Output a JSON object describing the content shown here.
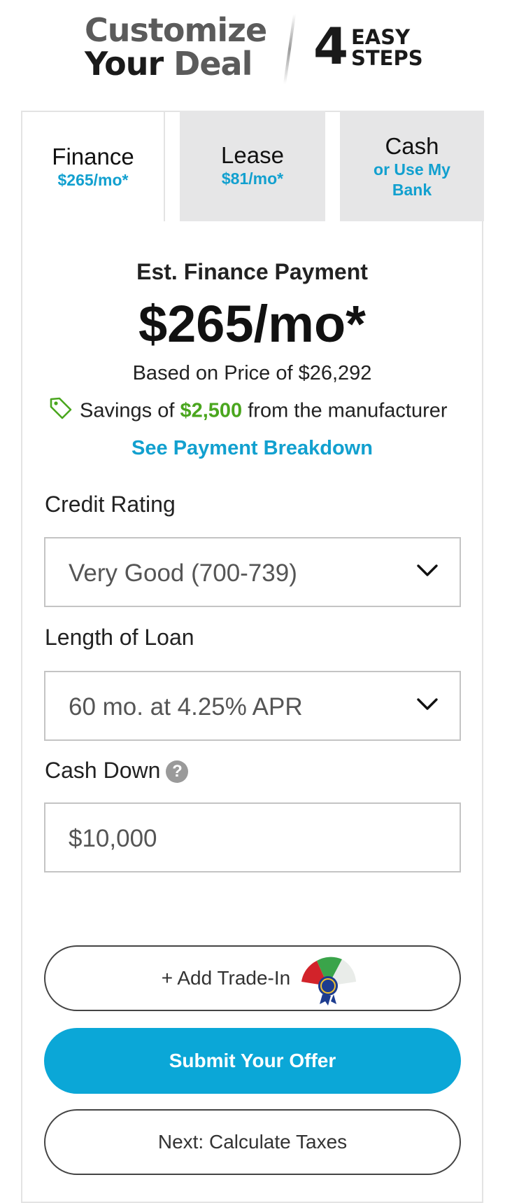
{
  "header": {
    "logo_line1": "Customize",
    "logo_line2a": "Your",
    "logo_line2b": "Deal",
    "steps_number": "4",
    "steps_easy": "EASY",
    "steps_steps": "STEPS"
  },
  "tabs": [
    {
      "title": "Finance",
      "subtitle": "$265/mo*",
      "active": true
    },
    {
      "title": "Lease",
      "subtitle": "$81/mo*",
      "active": false
    },
    {
      "title": "Cash",
      "subtitle": "or Use My Bank",
      "active": false
    }
  ],
  "summary": {
    "label": "Est. Finance Payment",
    "payment": "$265/mo*",
    "based_on": "Based on Price of $26,292",
    "savings_prefix": "Savings of",
    "savings_amount": "$2,500",
    "savings_suffix": "from the manufacturer",
    "breakdown_link": "See Payment Breakdown"
  },
  "form": {
    "credit_label": "Credit Rating",
    "credit_value": "Very Good (700-739)",
    "loan_label": "Length of Loan",
    "loan_value": "60 mo. at 4.25% APR",
    "cash_label": "Cash Down",
    "cash_help": "?",
    "cash_value": "$10,000"
  },
  "buttons": {
    "trade_in": "+ Add Trade-In",
    "submit": "Submit Your Offer",
    "next": "Next: Calculate Taxes"
  },
  "colors": {
    "accent": "#0ba7d7",
    "link": "#12a0cf",
    "savings": "#4aa61e",
    "tab_inactive": "#e6e6e7"
  },
  "icons": {
    "savings": "price-tag-icon",
    "dropdown": "chevron-down-icon",
    "help": "question-circle-icon",
    "trade_in": "kelley-blue-book-icon"
  }
}
